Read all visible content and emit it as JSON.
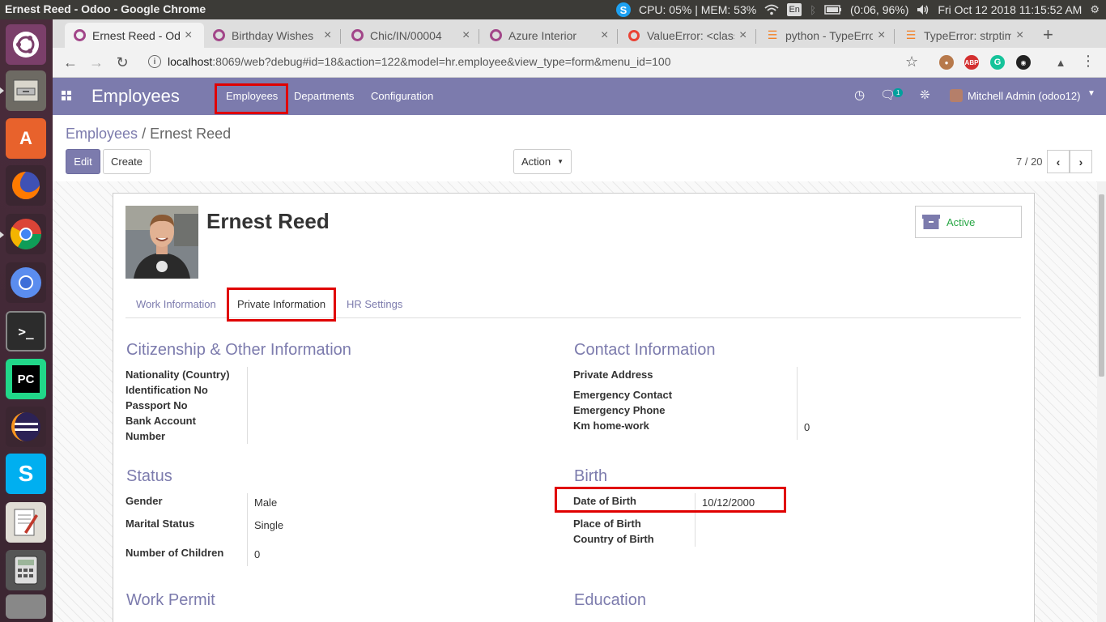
{
  "os": {
    "window_title": "Ernest Reed - Odoo - Google Chrome",
    "cpu_mem": "CPU: 05% | MEM: 53%",
    "keyboard": "En",
    "battery": "(0:06, 96%)",
    "datetime": "Fri Oct 12 2018 11:15:52 AM"
  },
  "browser": {
    "tabs": [
      {
        "label": "Ernest Reed - Odoo",
        "favicon": "odoo-icon"
      },
      {
        "label": "Birthday Wishes",
        "favicon": "odoo-icon"
      },
      {
        "label": "Chic/IN/00004",
        "favicon": "odoo-icon"
      },
      {
        "label": "Azure Interior",
        "favicon": "odoo-icon"
      },
      {
        "label": "ValueError: <class",
        "favicon": "google-icon"
      },
      {
        "label": "python - TypeError",
        "favicon": "stackoverflow-icon"
      },
      {
        "label": "TypeError: strptime",
        "favicon": "stackoverflow-icon"
      }
    ],
    "url_host": "localhost",
    "url_rest": ":8069/web?debug#id=18&action=122&model=hr.employee&view_type=form&menu_id=100"
  },
  "odoo_nav": {
    "app_title": "Employees",
    "menu": [
      "Employees",
      "Departments",
      "Configuration"
    ],
    "chat_count": "1",
    "user": "Mitchell Admin (odoo12)"
  },
  "control_panel": {
    "breadcrumb_parent": "Employees",
    "breadcrumb_sep": "/",
    "breadcrumb_current": "Ernest Reed",
    "edit_label": "Edit",
    "create_label": "Create",
    "action_label": "Action",
    "pager": "7 / 20"
  },
  "employee": {
    "name": "Ernest Reed",
    "status_button": "Active"
  },
  "form_tabs": [
    "Work Information",
    "Private Information",
    "HR Settings"
  ],
  "sections": {
    "citizenship": {
      "title": "Citizenship & Other Information",
      "fields": [
        "Nationality (Country)",
        "Identification No",
        "Passport No",
        "Bank Account",
        "Number"
      ]
    },
    "contact": {
      "title": "Contact Information",
      "fields": [
        "Private Address",
        "Emergency Contact",
        "Emergency Phone",
        "Km home-work"
      ],
      "km_home_work": "0"
    },
    "status": {
      "title": "Status",
      "gender_label": "Gender",
      "gender": "Male",
      "marital_label": "Marital Status",
      "marital": "Single",
      "children_label": "Number of Children",
      "children": "0"
    },
    "birth": {
      "title": "Birth",
      "dob_label": "Date of Birth",
      "dob": "10/12/2000",
      "place_label": "Place of Birth",
      "country_label": "Country of Birth"
    },
    "work_permit": {
      "title": "Work Permit"
    },
    "education": {
      "title": "Education"
    }
  },
  "colors": {
    "odoo_purple": "#7c7bad",
    "highlight_red": "#e00000",
    "active_green": "#28a745"
  }
}
